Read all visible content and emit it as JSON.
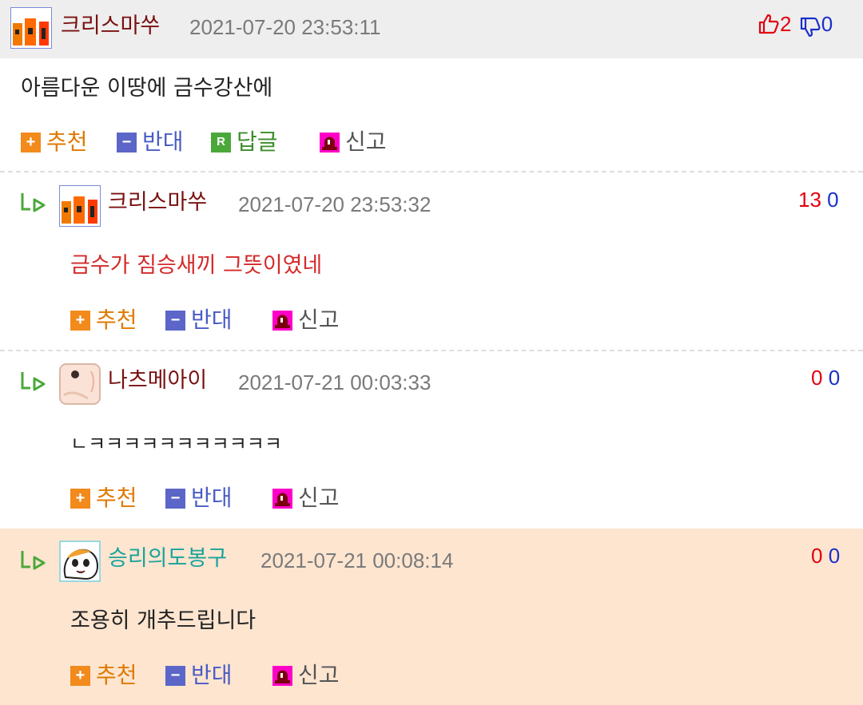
{
  "comment": {
    "nickname": "크리스마쑤",
    "datetime": "2021-07-20 23:53:11",
    "body": "아름다운 이땅에 금수강산에",
    "up": "2",
    "down": "0",
    "actions": {
      "recommend": "추천",
      "oppose": "반대",
      "reply": "답글",
      "report": "신고"
    },
    "reply_icon_letter": "R"
  },
  "replies": [
    {
      "nickname": "크리스마쑤",
      "datetime": "2021-07-20 23:53:32",
      "body": "금수가 짐승새끼 그뜻이였네",
      "up": "13",
      "down": "0",
      "nick_color": "#7a1010",
      "body_color": "#d42a2a",
      "actions": {
        "recommend": "추천",
        "oppose": "반대",
        "report": "신고"
      }
    },
    {
      "nickname": "나츠메아이",
      "datetime": "2021-07-21 00:03:33",
      "body": "ㄴㅋㅋㅋㅋㅋㅋㅋㅋㅋㅋㅋ",
      "up": "0",
      "down": "0",
      "nick_color": "#7a1010",
      "body_color": "#222222",
      "actions": {
        "recommend": "추천",
        "oppose": "반대",
        "report": "신고"
      }
    },
    {
      "nickname": "승리의도봉구",
      "datetime": "2021-07-21 00:08:14",
      "body": "조용히 개추드립니다",
      "up": "0",
      "down": "0",
      "nick_color": "#1aa39a",
      "body_color": "#222222",
      "actions": {
        "recommend": "추천",
        "oppose": "반대",
        "report": "신고"
      }
    }
  ],
  "colors": {
    "vote_up": "#e3000f",
    "vote_down": "#1a2fc9",
    "highlight_row": "#fde5d0",
    "header_bg": "#eeeeee"
  },
  "icons": {
    "thumbs_up": "thumbs-up-icon",
    "thumbs_down": "thumbs-down-icon",
    "reply_arrow": "reply-arrow-icon",
    "plus": "plus-icon",
    "minus": "minus-icon",
    "reply": "reply-icon",
    "report": "siren-icon"
  }
}
